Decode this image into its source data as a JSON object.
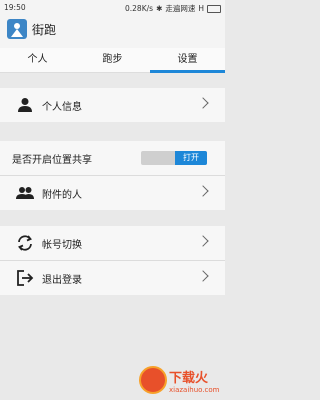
{
  "status_bar": {
    "time": "19:50",
    "network_speed": "0.28K/s",
    "carrier": "走遍网速",
    "battery_letter": "H"
  },
  "app": {
    "title": "街跑"
  },
  "tabs": [
    {
      "label": "个人",
      "active": false
    },
    {
      "label": "跑步",
      "active": false
    },
    {
      "label": "设置",
      "active": true
    }
  ],
  "settings": {
    "personal_info": {
      "label": "个人信息",
      "icon": "person-icon"
    },
    "location_share": {
      "label": "是否开启位置共享",
      "toggle_on_label": "打开"
    },
    "nearby_people": {
      "label": "附件的人",
      "icon": "people-icon"
    },
    "switch_account": {
      "label": "帐号切换",
      "icon": "sync-icon"
    },
    "logout": {
      "label": "退出登录",
      "icon": "logout-icon"
    }
  },
  "watermark": {
    "text": "下载火",
    "sub": "xiazaihuo.com"
  },
  "colors": {
    "accent": "#1d87d8",
    "background": "#e9e9e9"
  }
}
